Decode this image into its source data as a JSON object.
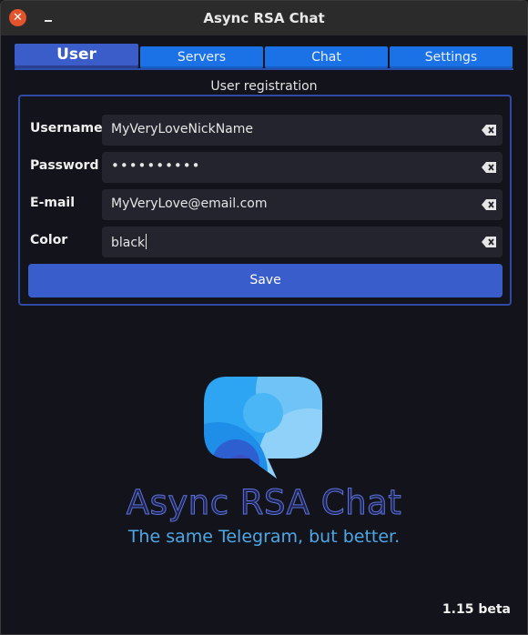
{
  "window": {
    "title": "Async RSA Chat"
  },
  "tabs": [
    {
      "label": "User",
      "active": true
    },
    {
      "label": "Servers",
      "active": false
    },
    {
      "label": "Chat",
      "active": false
    },
    {
      "label": "Settings",
      "active": false
    }
  ],
  "registration": {
    "section_label": "User registration",
    "fields": [
      {
        "label": "Username",
        "value": "MyVeryLoveNickName"
      },
      {
        "label": "Password",
        "value": "••••••••••"
      },
      {
        "label": "E-mail",
        "value": "MyVeryLove@email.com"
      },
      {
        "label": "Color",
        "value": "black"
      }
    ],
    "save_label": "Save"
  },
  "brand": {
    "name": "Async RSA Chat",
    "tagline": "The same Telegram, but better."
  },
  "version": "1.15 beta",
  "colors": {
    "accent": "#3a5dcc",
    "tab": "#1a72e6",
    "close": "#e3542c",
    "background": "#13141b"
  }
}
